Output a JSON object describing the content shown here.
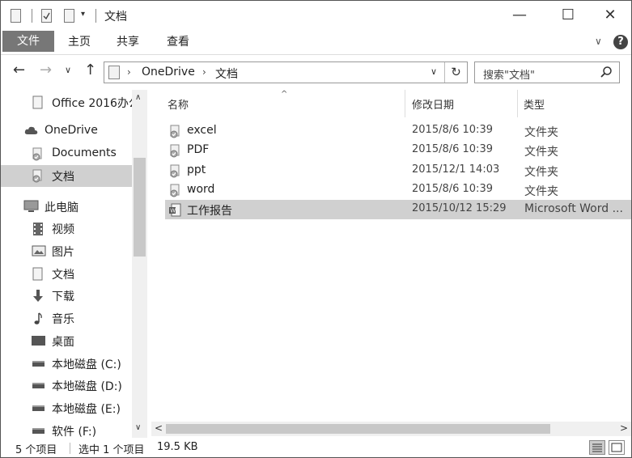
{
  "window": {
    "title": "文档",
    "minimize_glyph": "—",
    "maximize_glyph": "☐",
    "close_glyph": "✕"
  },
  "ribbon": {
    "tabs": [
      "文件",
      "主页",
      "共享",
      "查看"
    ],
    "expand_glyph": "∨",
    "help_glyph": "?"
  },
  "address": {
    "back_glyph": "←",
    "forward_glyph": "→",
    "recent_glyph": "∨",
    "up_glyph": "↑",
    "crumbs": [
      "OneDrive",
      "文档"
    ],
    "crumb_sep": "›",
    "dropdown_glyph": "∨",
    "refresh_glyph": "↻"
  },
  "search": {
    "placeholder": "搜索\"文档\"",
    "icon": "search-icon"
  },
  "nav_pane": {
    "items": [
      {
        "label": "Office 2016办公",
        "icon": "document-icon"
      },
      {
        "label": "OneDrive",
        "icon": "cloud-icon"
      },
      {
        "label": "Documents",
        "icon": "synced-folder-icon"
      },
      {
        "label": "文档",
        "icon": "synced-folder-icon",
        "selected": true
      },
      {
        "label": "此电脑",
        "icon": "computer-icon"
      },
      {
        "label": "视频",
        "icon": "video-icon"
      },
      {
        "label": "图片",
        "icon": "picture-icon"
      },
      {
        "label": "文档",
        "icon": "document-icon"
      },
      {
        "label": "下载",
        "icon": "download-icon"
      },
      {
        "label": "音乐",
        "icon": "music-icon"
      },
      {
        "label": "桌面",
        "icon": "desktop-icon"
      },
      {
        "label": "本地磁盘 (C:)",
        "icon": "drive-icon"
      },
      {
        "label": "本地磁盘 (D:)",
        "icon": "drive-icon"
      },
      {
        "label": "本地磁盘 (E:)",
        "icon": "drive-icon"
      },
      {
        "label": "软件 (F:)",
        "icon": "drive-icon"
      }
    ],
    "scroll_up_glyph": "∧",
    "scroll_down_glyph": "∨"
  },
  "file_list": {
    "columns": [
      "名称",
      "修改日期",
      "类型"
    ],
    "sort_glyph": "^",
    "rows": [
      {
        "name": "excel",
        "date": "2015/8/6 10:39",
        "type": "文件夹",
        "icon": "synced-folder-icon"
      },
      {
        "name": "PDF",
        "date": "2015/8/6 10:39",
        "type": "文件夹",
        "icon": "synced-folder-icon"
      },
      {
        "name": "ppt",
        "date": "2015/12/1 14:03",
        "type": "文件夹",
        "icon": "synced-folder-icon"
      },
      {
        "name": "word",
        "date": "2015/8/6 10:39",
        "type": "文件夹",
        "icon": "synced-folder-icon"
      },
      {
        "name": "工作报告",
        "date": "2015/10/12 15:29",
        "type": "Microsoft Word ...",
        "icon": "word-document-icon",
        "selected": true
      }
    ],
    "hscroll_left_glyph": "<",
    "hscroll_right_glyph": ">"
  },
  "status_bar": {
    "item_count": "5 个项目",
    "selection": "选中 1 个项目",
    "size": "19.5 KB"
  }
}
